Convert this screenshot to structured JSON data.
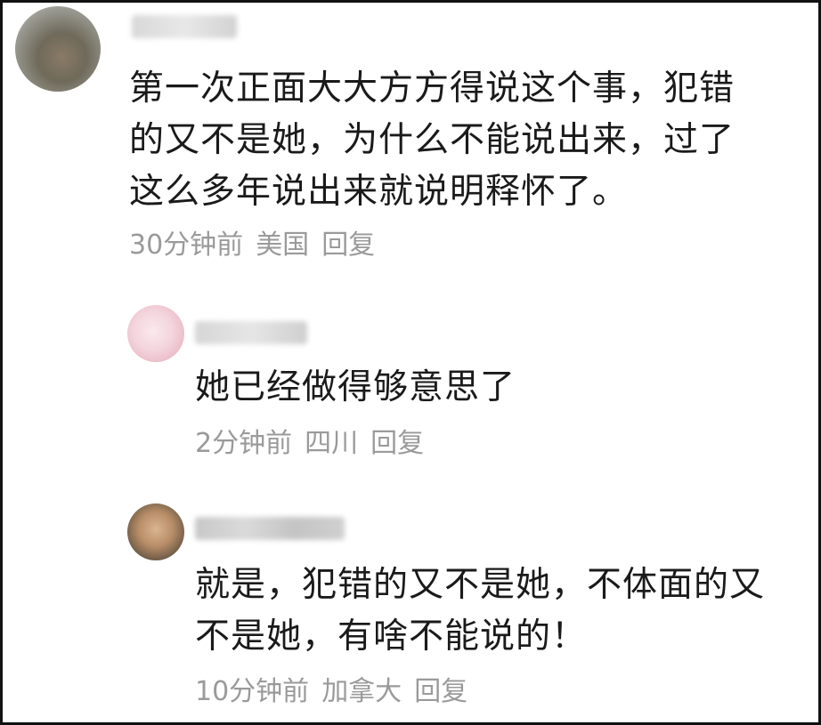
{
  "comments": [
    {
      "content": "第一次正面大大方方得说这个事，犯错\n的又不是她，为什么不能说出来，过了\n这么多年说出来就说明释怀了。",
      "time": "30分钟前",
      "location": "美国",
      "reply_label": "回复"
    },
    {
      "content": "她已经做得够意思了",
      "time": "2分钟前",
      "location": "四川",
      "reply_label": "回复"
    },
    {
      "content": "就是，犯错的又不是她，不体面的又\n不是她，有啥不能说的！",
      "time": "10分钟前",
      "location": "加拿大",
      "reply_label": "回复"
    }
  ],
  "colors": {
    "text": "#1a1a1a",
    "meta": "#9a9a9a",
    "border": "#111111",
    "background": "#ffffff"
  }
}
